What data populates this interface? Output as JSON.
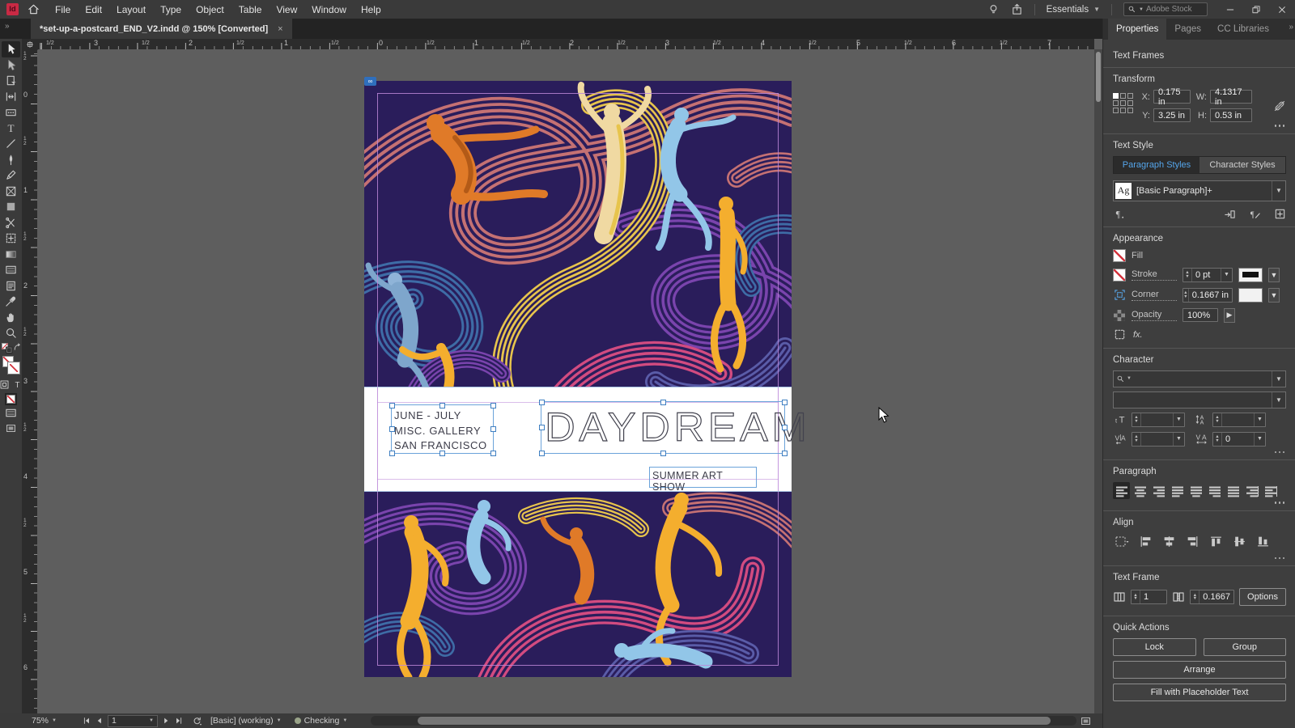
{
  "menubar": {
    "logo": "Id",
    "menus": [
      "File",
      "Edit",
      "Layout",
      "Type",
      "Object",
      "Table",
      "View",
      "Window",
      "Help"
    ],
    "workspace": "Essentials",
    "search_placeholder": "Adobe Stock"
  },
  "tabbar": {
    "doc_title": "*set-up-a-postcard_END_V2.indd @ 150% [Converted]",
    "close": "×"
  },
  "toolbar": {
    "active_tool": "selection",
    "tools": [
      "selection",
      "direct-selection",
      "page",
      "gap",
      "content-collector",
      "type",
      "line",
      "pen",
      "pencil",
      "rectangle-frame",
      "rectangle",
      "scissors",
      "free-transform",
      "gradient-swatch",
      "gradient-feather",
      "note",
      "color-theme",
      "hand",
      "zoom"
    ]
  },
  "rulers": {
    "horizontal": [
      [
        "1/2",
        55
      ],
      [
        "3",
        114
      ],
      [
        "1/2",
        173
      ],
      [
        "2",
        231
      ],
      [
        "1/2",
        290
      ],
      [
        "1",
        349
      ],
      [
        "1/2",
        407
      ],
      [
        "0",
        466
      ],
      [
        "1/2",
        525
      ],
      [
        "1",
        584
      ],
      [
        "1/2",
        643
      ],
      [
        "2",
        702
      ],
      [
        "1/2",
        761
      ],
      [
        "3",
        820
      ],
      [
        "1/2",
        879
      ],
      [
        "4",
        938
      ],
      [
        "1/2",
        997
      ],
      [
        "5",
        1056
      ],
      [
        "1/2",
        1115
      ],
      [
        "6",
        1174
      ],
      [
        "1/2",
        1233
      ],
      [
        "7",
        1292
      ],
      [
        "1/2",
        1351
      ]
    ],
    "vertical": [
      [
        "1/2",
        70
      ],
      [
        "0",
        116
      ],
      [
        "1/2",
        175
      ],
      [
        "1",
        234
      ],
      [
        "1/2",
        293
      ],
      [
        "2",
        352
      ],
      [
        "1/2",
        411
      ],
      [
        "3",
        470
      ],
      [
        "1/2",
        529
      ],
      [
        "4",
        588
      ],
      [
        "1/2",
        647
      ],
      [
        "5",
        706
      ],
      [
        "1/2",
        765
      ],
      [
        "6",
        824
      ]
    ]
  },
  "document": {
    "texts": {
      "dates": "JUNE - JULY",
      "gallery": "MISC. GALLERY",
      "city": "SAN FRANCISCO",
      "title": "DAYDREAM",
      "subtitle": "SUMMER ART SHOW"
    }
  },
  "properties_panel": {
    "tabs": [
      {
        "label": "Properties",
        "active": true
      },
      {
        "label": "Pages",
        "active": false
      },
      {
        "label": "CC Libraries",
        "active": false
      }
    ],
    "selection_type": "Text Frames",
    "transform": {
      "title": "Transform",
      "x_label": "X:",
      "x": "0.175 in",
      "y_label": "Y:",
      "y": "3.25 in",
      "w_label": "W:",
      "w": "4.1317 in",
      "h_label": "H:",
      "h": "0.53 in"
    },
    "text_style": {
      "title": "Text Style",
      "paragraph_tab": "Paragraph Styles",
      "character_tab": "Character Styles",
      "style_icon": "Ag",
      "style_name": "[Basic Paragraph]+"
    },
    "appearance": {
      "title": "Appearance",
      "fill_label": "Fill",
      "stroke_label": "Stroke",
      "stroke_weight": "0 pt",
      "corner_label": "Corner",
      "corner_radius": "0.1667 in",
      "opacity_label": "Opacity",
      "opacity": "100%",
      "fx_label": "fx."
    },
    "character": {
      "title": "Character",
      "tracking": "0"
    },
    "paragraph": {
      "title": "Paragraph"
    },
    "align": {
      "title": "Align"
    },
    "text_frame": {
      "title": "Text Frame",
      "columns": "1",
      "gutter": "0.1667",
      "options_label": "Options"
    },
    "quick_actions": {
      "title": "Quick Actions",
      "lock": "Lock",
      "group": "Group",
      "arrange": "Arrange",
      "fill_placeholder": "Fill with Placeholder Text"
    }
  },
  "statusbar": {
    "zoom_level": "75%",
    "page_number": "1",
    "preflight_profile": "[Basic] (working)",
    "preflight_status": "Checking"
  },
  "colors": {
    "accent_blue": "#55a5ea",
    "selection_blue": "#3f7fc1",
    "guide_violet": "#bb86d8",
    "art_background": "#2a1d5b",
    "art_palette": [
      "#c57173",
      "#d24b80",
      "#7a44ad",
      "#3e6ca6",
      "#e7c44c",
      "#5a5ca8",
      "#e07a28",
      "#f4ae2e",
      "#f0d9a2",
      "#92c6e8"
    ]
  }
}
